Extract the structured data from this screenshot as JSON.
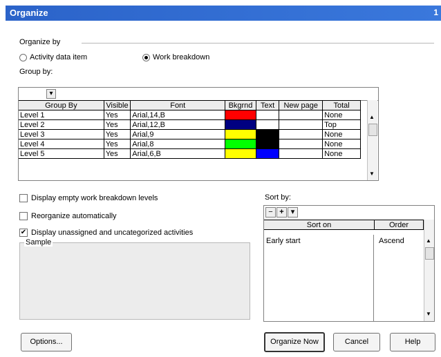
{
  "title": "Organize",
  "close_glyph": "1",
  "organize_by": {
    "label": "Organize by",
    "options": [
      {
        "label": "Activity data item",
        "selected": false
      },
      {
        "label": "Work breakdown",
        "selected": true
      }
    ]
  },
  "group_by": {
    "label": "Group by:",
    "columns": [
      "Group By",
      "Visible",
      "Font",
      "Bkgrnd",
      "Text",
      "New page",
      "Total"
    ],
    "rows": [
      {
        "group": "Level 1",
        "visible": "Yes",
        "font": "Arial,14,B",
        "bkgrnd": "#ff0000",
        "text": "#ffffff",
        "new_page": "",
        "total": "None"
      },
      {
        "group": "Level 2",
        "visible": "Yes",
        "font": "Arial,12,B",
        "bkgrnd": "#000080",
        "text": "#ffffff",
        "new_page": "",
        "total": "Top"
      },
      {
        "group": "Level 3",
        "visible": "Yes",
        "font": "Arial,9",
        "bkgrnd": "#ffff00",
        "text": "#000000",
        "new_page": "",
        "total": "None"
      },
      {
        "group": "Level 4",
        "visible": "Yes",
        "font": "Arial,8",
        "bkgrnd": "#00ff00",
        "text": "#000000",
        "new_page": "",
        "total": "None"
      },
      {
        "group": "Level 5",
        "visible": "Yes",
        "font": "Arial,6,B",
        "bkgrnd": "#ffff00",
        "text": "#0000ff",
        "new_page": "",
        "total": "None"
      }
    ]
  },
  "options": [
    {
      "label": "Display empty work breakdown levels",
      "checked": false
    },
    {
      "label": "Reorganize automatically",
      "checked": false
    },
    {
      "label": "Display unassigned and uncategorized activities",
      "checked": true
    }
  ],
  "sample": {
    "label": "Sample"
  },
  "sort_by": {
    "label": "Sort by:",
    "columns": [
      "Sort on",
      "Order"
    ],
    "rows": [
      {
        "sort_on": "Early start",
        "order": "Ascend"
      }
    ],
    "remove_glyph": "−",
    "add_glyph": "+"
  },
  "buttons": {
    "options": "Options...",
    "organize_now": "Organize Now",
    "cancel": "Cancel",
    "help": "Help"
  },
  "icons": {
    "dropdown": "▾",
    "up": "▲",
    "down": "▼",
    "check": "✔"
  }
}
